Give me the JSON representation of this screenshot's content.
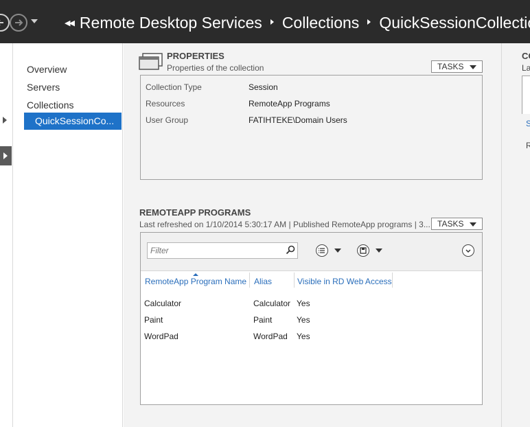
{
  "breadcrumb": {
    "items": [
      "Remote Desktop Services",
      "Collections",
      "QuickSessionCollection"
    ]
  },
  "nav": {
    "items": [
      {
        "label": "Overview"
      },
      {
        "label": "Servers"
      },
      {
        "label": "Collections"
      },
      {
        "label": "QuickSessionCo..."
      }
    ],
    "selected_index": 3
  },
  "properties": {
    "title": "PROPERTIES",
    "subtitle": "Properties of the collection",
    "tasks_label": "TASKS",
    "rows": [
      {
        "label": "Collection Type",
        "value": "Session"
      },
      {
        "label": "Resources",
        "value": "RemoteApp Programs"
      },
      {
        "label": "User Group",
        "value": "FATIHTEKE\\Domain Users"
      }
    ]
  },
  "remoteapp": {
    "title": "REMOTEAPP PROGRAMS",
    "subtitle": "Last refreshed on 1/10/2014 5:30:17 AM | Published RemoteApp programs  | 3...",
    "tasks_label": "TASKS",
    "filter_placeholder": "Filter",
    "columns": [
      "RemoteApp Program Name",
      "Alias",
      "Visible in RD Web Access"
    ],
    "rows": [
      {
        "name": "Calculator",
        "alias": "Calculator",
        "visible": "Yes"
      },
      {
        "name": "Paint",
        "alias": "Paint",
        "visible": "Yes"
      },
      {
        "name": "WordPad",
        "alias": "WordPad",
        "visible": "Yes"
      }
    ]
  },
  "right_column": {
    "title_fragment": "CO",
    "subtitle_fragment": "La",
    "link_fragment": "S",
    "text_fragment": "R"
  },
  "colors": {
    "header_bg": "#2b2b2b",
    "selection": "#1e72c8",
    "link": "#2a6ebb",
    "panel_bg": "#f3f3f3"
  }
}
